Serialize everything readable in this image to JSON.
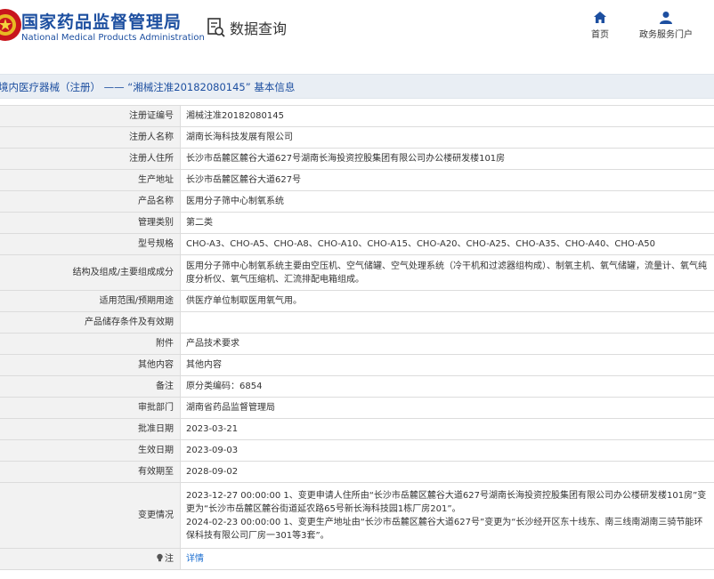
{
  "header": {
    "brand_cn": "国家药品监督管理局",
    "brand_en": "National Medical Products Administration",
    "data_query": "数据查询",
    "nav_home": "首页",
    "nav_service": "政务服务门户",
    "brand_color": "#1d4fa0",
    "logo_icon": "nmpa-emblem-icon",
    "data_query_icon": "search-document-icon",
    "home_icon": "home-icon",
    "service_icon": "user-icon"
  },
  "page_title": "境内医疗器械（注册） —— “湘械注准20182080145” 基本信息",
  "rows": [
    {
      "label": "注册证编号",
      "value": "湘械注准20182080145",
      "h": 24
    },
    {
      "label": "注册人名称",
      "value": "湖南长海科技发展有限公司",
      "h": 24
    },
    {
      "label": "注册人住所",
      "value": "长沙市岳麓区麓谷大道627号湖南长海投资控股集团有限公司办公楼研发楼101房",
      "h": 24
    },
    {
      "label": "生产地址",
      "value": "长沙市岳麓区麓谷大道627号",
      "h": 24
    },
    {
      "label": "产品名称",
      "value": "医用分子筛中心制氧系统",
      "h": 24
    },
    {
      "label": "管理类别",
      "value": "第二类",
      "h": 24
    },
    {
      "label": "型号规格",
      "value": "CHO-A3、CHO-A5、CHO-A8、CHO-A10、CHO-A15、CHO-A20、CHO-A25、CHO-A35、CHO-A40、CHO-A50",
      "h": 24
    },
    {
      "label": "结构及组成/主要组成成分",
      "value": "医用分子筛中心制氧系统主要由空压机、空气储罐、空气处理系统（冷干机和过滤器组构成）、制氧主机、氧气储罐，流量计、氧气纯度分析仪、氧气压缩机、汇流排配电箱组成。",
      "h": 40
    },
    {
      "label": "适用范围/预期用途",
      "value": "供医疗单位制取医用氧气用。",
      "h": 24
    },
    {
      "label": "产品储存条件及有效期",
      "value": "",
      "h": 24
    },
    {
      "label": "附件",
      "value": "产品技术要求",
      "h": 24
    },
    {
      "label": "其他内容",
      "value": "其他内容",
      "h": 24
    },
    {
      "label": "备注",
      "value": "原分类编码：6854",
      "h": 24
    },
    {
      "label": "审批部门",
      "value": "湖南省药品监督管理局",
      "h": 24
    },
    {
      "label": "批准日期",
      "value": "2023-03-21",
      "h": 24
    },
    {
      "label": "生效日期",
      "value": "2023-09-03",
      "h": 24
    },
    {
      "label": "有效期至",
      "value": "2028-09-02",
      "h": 24
    },
    {
      "label": "变更情况",
      "value": "2023-12-27 00:00:00 1、变更申请人住所由“长沙市岳麓区麓谷大道627号湖南长海投资控股集团有限公司办公楼研发楼101房”变更为“长沙市岳麓区麓谷街道延农路65号新长海科技园1栋厂房201”。\n2024-02-23 00:00:00 1、变更生产地址由“长沙市岳麓区麓谷大道627号”变更为“长沙经开区东十线东、南三线南湖南三骑节能环保科技有限公司厂房一301等3套”。",
      "h": 74
    }
  ],
  "note": {
    "label": "注",
    "icon": "bulb-icon",
    "link_text": "详情"
  }
}
